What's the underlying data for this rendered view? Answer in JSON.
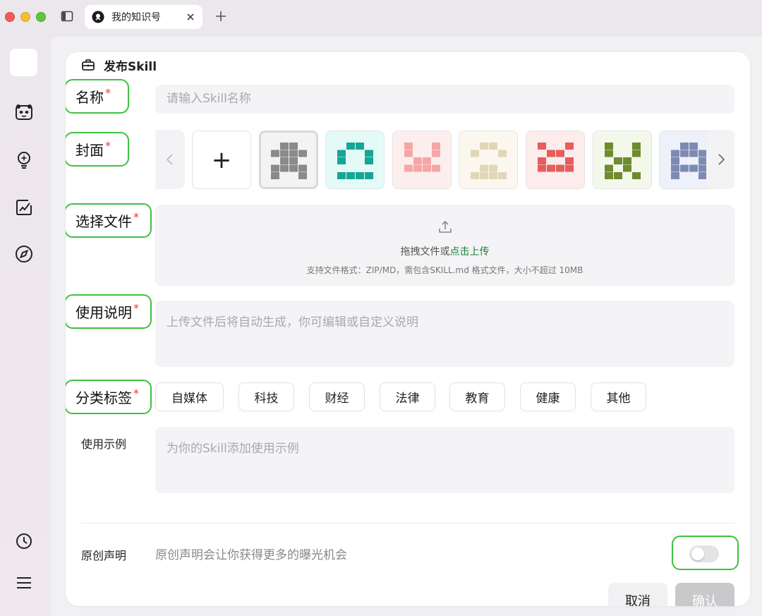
{
  "browser": {
    "tab_title": "我的知识号"
  },
  "dialog": {
    "title": "发布Skill",
    "fields": {
      "name": {
        "label": "名称",
        "required_mark": "*",
        "placeholder": "请输入Skill名称"
      },
      "cover": {
        "label": "封面",
        "required_mark": "*",
        "add_label": "+"
      },
      "file": {
        "label": "选择文件",
        "required_mark": "*",
        "drop_text": "拖拽文件或",
        "link_text": "点击上传",
        "hint": "支持文件格式：ZIP/MD，需包含SKILL.md 格式文件，大小不超过 10MB"
      },
      "instructions": {
        "label": "使用说明",
        "required_mark": "*",
        "placeholder": "上传文件后将自动生成，你可编辑或自定义说明"
      },
      "tags": {
        "label": "分类标签",
        "required_mark": "*",
        "options": [
          "自媒体",
          "科技",
          "财经",
          "法律",
          "教育",
          "健康",
          "其他"
        ]
      },
      "example": {
        "label": "使用示例",
        "placeholder": "为你的Skill添加使用示例"
      },
      "original": {
        "label": "原创声明",
        "description": "原创声明会让你获得更多的曝光机会",
        "enabled": false
      }
    },
    "buttons": {
      "cancel": "取消",
      "confirm": "确认"
    }
  },
  "covers": [
    {
      "name": "gray",
      "color": "#8a8a8a",
      "bg": "#f3f3f3"
    },
    {
      "name": "teal",
      "color": "#16a596",
      "bg": "#e4faf7"
    },
    {
      "name": "pink",
      "color": "#f6a6a6",
      "bg": "#fdeeee"
    },
    {
      "name": "beige",
      "color": "#e2d6b8",
      "bg": "#fbf7ee"
    },
    {
      "name": "red",
      "color": "#e55d5d",
      "bg": "#fdecec"
    },
    {
      "name": "olive",
      "color": "#6e8c2e",
      "bg": "#f3f8ea"
    },
    {
      "name": "slate",
      "color": "#7d8bb3",
      "bg": "#eef1fa"
    }
  ],
  "colors": {
    "accent_green": "#3ec13e",
    "required_red": "#e33b3b",
    "link_green": "#1d7f3a"
  }
}
